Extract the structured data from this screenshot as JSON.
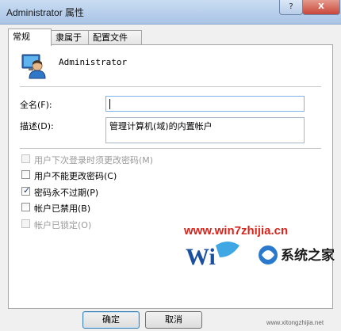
{
  "window": {
    "title": "Administrator 属性",
    "help_glyph": "?",
    "close_glyph": "X"
  },
  "tabs": [
    {
      "label": "常规",
      "active": true
    },
    {
      "label": "隶属于",
      "active": false
    },
    {
      "label": "配置文件",
      "active": false
    }
  ],
  "account": {
    "name": "Administrator"
  },
  "fields": {
    "full_name_label": "全名(F):",
    "full_name_value": "",
    "description_label": "描述(D):",
    "description_value": "管理计算机(域)的内置帐户"
  },
  "checkboxes": [
    {
      "label": "用户下次登录时须更改密码(M)",
      "checked": false,
      "enabled": false
    },
    {
      "label": "用户不能更改密码(C)",
      "checked": false,
      "enabled": true
    },
    {
      "label": "密码永不过期(P)",
      "checked": true,
      "enabled": true
    },
    {
      "label": "帐户已禁用(B)",
      "checked": false,
      "enabled": true
    },
    {
      "label": "帐户已锁定(O)",
      "checked": false,
      "enabled": false
    }
  ],
  "buttons": {
    "ok": "确定",
    "cancel": "取消"
  },
  "watermark": {
    "text": "www.win7zhijia.cn",
    "logo_text": "系统之家",
    "url": "www.xitongzhijia.net"
  },
  "colors": {
    "title_bar": "#b9d1ee",
    "close_button": "#c9463a",
    "watermark_red": "#d9241c",
    "checkbox_check": "#1b3e7a"
  }
}
